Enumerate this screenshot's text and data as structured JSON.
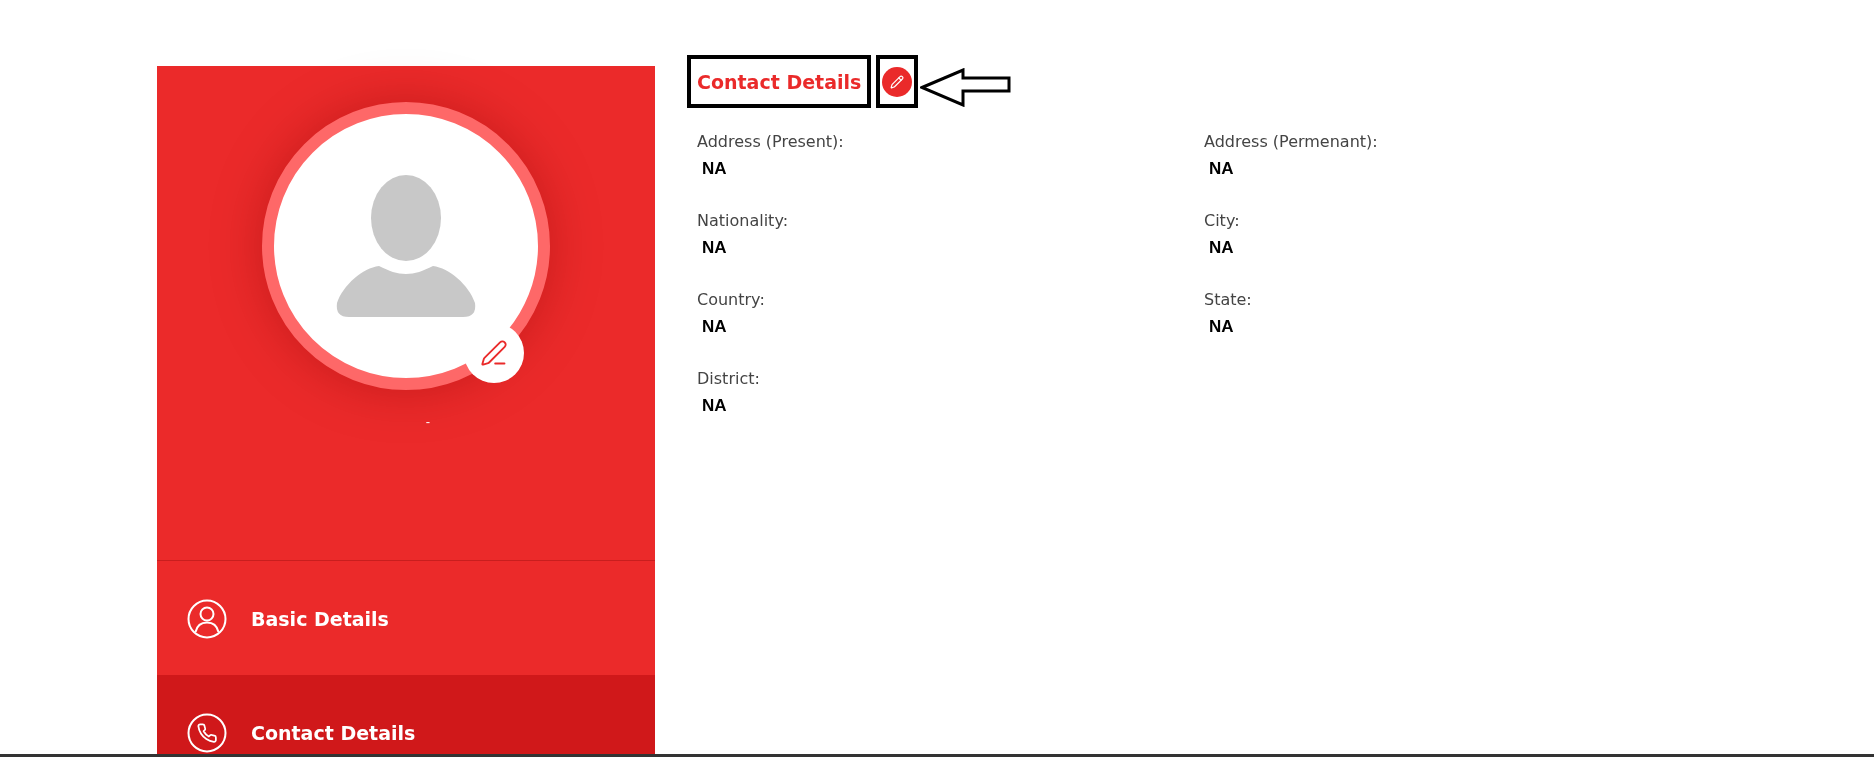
{
  "sidebar": {
    "profile": {
      "name": "-"
    },
    "items": [
      {
        "label": "Basic Details",
        "kind": "person",
        "selected": false
      },
      {
        "label": "Contact Details",
        "kind": "phone",
        "selected": true
      }
    ]
  },
  "section": {
    "title": "Contact Details",
    "title_framed": true,
    "edit_framed": true,
    "edit_arrow": true,
    "fields": [
      {
        "label": "Address (Present):",
        "value": "NA"
      },
      {
        "label": "Address (Permenant):",
        "value": "NA"
      },
      {
        "label": "Nationality:",
        "value": "NA"
      },
      {
        "label": "City:",
        "value": "NA"
      },
      {
        "label": "Country:",
        "value": "NA"
      },
      {
        "label": "State:",
        "value": "NA"
      },
      {
        "label": "District:",
        "value": "NA"
      }
    ]
  }
}
